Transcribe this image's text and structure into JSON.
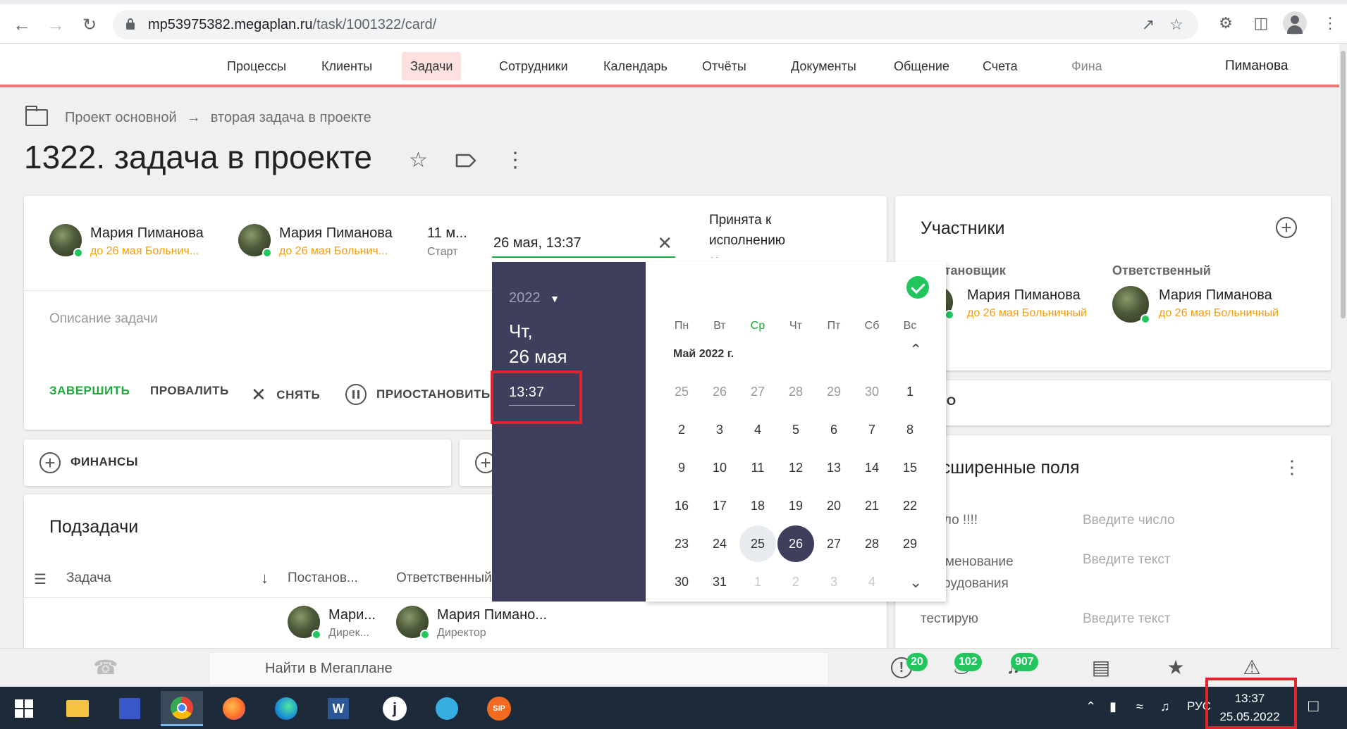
{
  "browser": {
    "url_host": "mp53975382.megaplan.ru",
    "url_path": "/task/1001322/card/"
  },
  "header": {
    "menu": [
      {
        "label": "Процессы",
        "active": false
      },
      {
        "label": "Клиенты",
        "active": false
      },
      {
        "label": "Задачи",
        "active": true
      },
      {
        "label": "Сотрудники",
        "active": false
      },
      {
        "label": "Календарь",
        "active": false
      },
      {
        "label": "Отчёты",
        "active": false
      },
      {
        "label": "Документы",
        "active": false
      },
      {
        "label": "Общение",
        "active": false
      },
      {
        "label": "Счета",
        "active": false
      },
      {
        "label": "Фина",
        "active": false
      }
    ],
    "user": "Пиманова"
  },
  "breadcrumb": {
    "project": "Проект основной",
    "arrow": "→",
    "parent": "вторая задача в проекте"
  },
  "task": {
    "title": "1322. задача в проекте",
    "owner": {
      "name": "Мария Пиманова",
      "status": "до 26 мая Больнич..."
    },
    "responsible": {
      "name": "Мария Пиманова",
      "status": "до 26 мая Больнич..."
    },
    "start": {
      "value": "11 м...",
      "label": "Старт"
    },
    "deadline_input": "26 мая, 13:37",
    "state": {
      "line1": "Принята к",
      "line2": "исполнению",
      "line3": "11 мая"
    },
    "description_placeholder": "Описание задачи",
    "actions": {
      "complete": "ЗАВЕРШИТЬ",
      "fail": "ПРОВАЛИТЬ",
      "cancel": "СНЯТЬ",
      "pause": "ПРИОСТАНОВИТЬ"
    },
    "finance": "ФИНАНСЫ"
  },
  "subtasks": {
    "title": "Подзадачи",
    "columns": {
      "task": "Задача",
      "setter": "Постанов...",
      "responsible": "Ответственный"
    },
    "row": {
      "setter_name": "Мари...",
      "setter_role": "Дирек...",
      "resp_name": "Мария Пимано...",
      "resp_role": "Директор"
    }
  },
  "participants": {
    "title": "Участники",
    "setter_label": "Постановщик",
    "setter": {
      "name": "Мария Пиманова",
      "status": "до 26 мая Больничный"
    },
    "responsible_label": "Ответственный",
    "responsible": {
      "name": "Мария Пиманова",
      "status": "до 26 мая Больничный"
    }
  },
  "deal": {
    "label": "Дело"
  },
  "extended": {
    "title": "Расширенные поля",
    "fields": [
      {
        "label": "Число !!!!",
        "placeholder": "Введите число"
      },
      {
        "label": "Наименование оборудования",
        "placeholder": "Введите текст"
      },
      {
        "label": "тестирую",
        "placeholder": "Введите текст"
      }
    ]
  },
  "datepicker": {
    "year": "2022",
    "weekday": "Чт,",
    "date": "26 мая",
    "time": "13:37",
    "month_title": "Май 2022 г.",
    "weekdays": [
      "Пн",
      "Вт",
      "Ср",
      "Чт",
      "Пт",
      "Сб",
      "Вс"
    ],
    "weeks": [
      [
        "25",
        "26",
        "27",
        "28",
        "29",
        "30",
        "1"
      ],
      [
        "2",
        "3",
        "4",
        "5",
        "6",
        "7",
        "8"
      ],
      [
        "9",
        "10",
        "11",
        "12",
        "13",
        "14",
        "15"
      ],
      [
        "16",
        "17",
        "18",
        "19",
        "20",
        "21",
        "22"
      ],
      [
        "23",
        "24",
        "25",
        "26",
        "27",
        "28",
        "29"
      ],
      [
        "30",
        "31",
        "1",
        "2",
        "3",
        "4",
        ""
      ]
    ]
  },
  "bottom": {
    "search_placeholder": "Найти в Мегаплане",
    "badges": {
      "alerts": "20",
      "fire": "102",
      "bell": "907"
    }
  },
  "taskbar": {
    "lang": "РУС",
    "time": "13:37",
    "date": "25.05.2022"
  },
  "colors": {
    "accent_red": "#f07878",
    "green": "#22c55e",
    "picker_dark": "#3d3f5c",
    "status_orange": "#f59e0b"
  }
}
